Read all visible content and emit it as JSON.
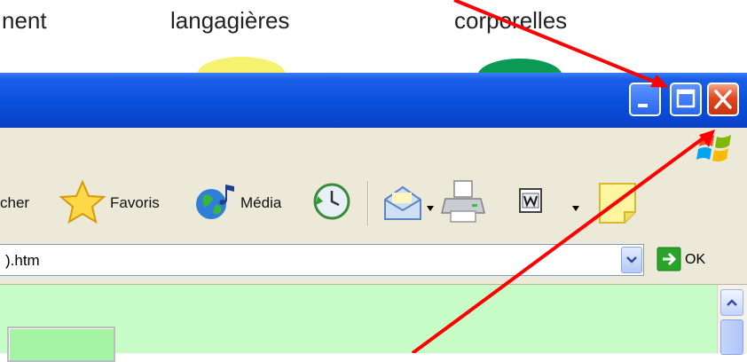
{
  "slide": {
    "words": [
      "nent",
      "langagières",
      "corporelles"
    ]
  },
  "toolbar": {
    "search_partial": "cher",
    "favorites_label": "Favoris",
    "media_label": "Média"
  },
  "address": {
    "value": ").htm",
    "go_label": "OK"
  },
  "colors": {
    "titlebar": "#0a4fdc",
    "close_button": "#e2471e",
    "annotation_arrow": "#ff0000",
    "page_background": "#c8fdc8"
  },
  "icons": [
    "minimize-icon",
    "maximize-icon",
    "close-icon",
    "windows-logo-icon",
    "star-icon",
    "media-globe-icon",
    "history-icon",
    "mail-icon",
    "print-icon",
    "word-icon",
    "chevron-down-icon",
    "go-arrow-icon",
    "scroll-up-icon",
    "note-icon"
  ]
}
